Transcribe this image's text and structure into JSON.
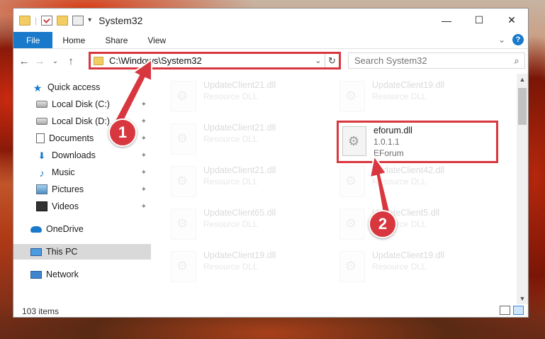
{
  "window": {
    "title": "System32",
    "controls": {
      "minimize": "—",
      "maximize": "☐",
      "close": "✕"
    }
  },
  "ribbon": {
    "tabs": [
      "File",
      "Home",
      "Share",
      "View"
    ],
    "collapse_glyph": "⌄",
    "help_glyph": "?"
  },
  "nav": {
    "back": "←",
    "forward": "→",
    "recent": "⌄",
    "up": "↑",
    "address": "C:\\Windows\\System32",
    "address_dropdown": "⌄",
    "refresh": "↻",
    "search_placeholder": "Search System32",
    "search_glyph": "⌕"
  },
  "sidebar": {
    "quick_access": "Quick access",
    "items": [
      {
        "label": "Local Disk (C:)",
        "icon": "drive-icon",
        "pinned": true
      },
      {
        "label": "Local Disk (D:)",
        "icon": "drive-icon",
        "pinned": true
      },
      {
        "label": "Documents",
        "icon": "documents-icon",
        "pinned": true
      },
      {
        "label": "Downloads",
        "icon": "downloads-icon",
        "pinned": true
      },
      {
        "label": "Music",
        "icon": "music-icon",
        "pinned": true
      },
      {
        "label": "Pictures",
        "icon": "pictures-icon",
        "pinned": true
      },
      {
        "label": "Videos",
        "icon": "videos-icon",
        "pinned": true
      }
    ],
    "onedrive": "OneDrive",
    "this_pc": "This PC",
    "network": "Network",
    "pin_glyph": "📌"
  },
  "files": {
    "left": [
      {
        "name": "UpdateClient21.dll",
        "type": "Resource DLL"
      },
      {
        "name": "UpdateClient21.dll",
        "type": "Resource DLL"
      },
      {
        "name": "UpdateClient21.dll",
        "type": "Resource DLL"
      },
      {
        "name": "UpdateClient65.dll",
        "type": "Resource DLL"
      },
      {
        "name": "UpdateClient19.dll",
        "type": "Resource DLL"
      }
    ],
    "right": [
      {
        "name": "UpdateClient19.dll",
        "type": "Resource DLL"
      },
      {
        "name": "eforum.dll",
        "version": "1.0.1.1",
        "company": "EForum",
        "highlighted": true
      },
      {
        "name": "UpdateClient42.dll",
        "type": "Resource DLL"
      },
      {
        "name": "UpdateClient5.dll",
        "type": "Resource DLL"
      },
      {
        "name": "UpdateClient19.dll",
        "type": "Resource DLL"
      }
    ]
  },
  "status": {
    "item_count": "103 items"
  },
  "annotations": {
    "step1": "1",
    "step2": "2",
    "accent_color": "#d9373f"
  },
  "colors": {
    "accent_blue": "#1979ca",
    "highlight_red": "#d9373f",
    "selection_gray": "#d9d9d9"
  }
}
